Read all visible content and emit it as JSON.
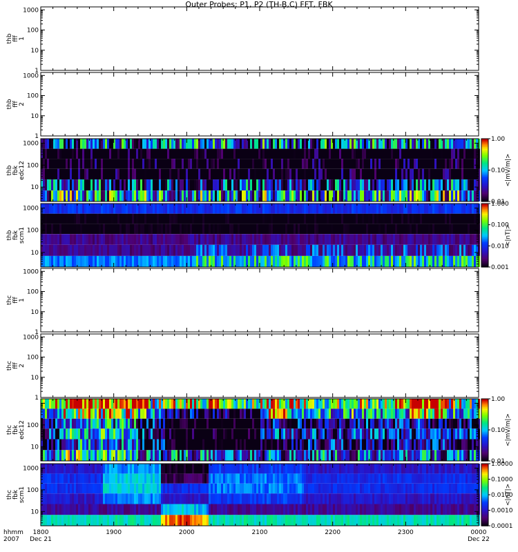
{
  "title": "Outer Probes: P1, P2 (TH-B,C) FFT, FBK",
  "x_axis": {
    "row_label_1": "hhmm",
    "row_label_2": "2007",
    "ticks": [
      {
        "t": "1800",
        "d": "Dec 21"
      },
      {
        "t": "1900",
        "d": ""
      },
      {
        "t": "2000",
        "d": ""
      },
      {
        "t": "2100",
        "d": ""
      },
      {
        "t": "2200",
        "d": ""
      },
      {
        "t": "2300",
        "d": ""
      },
      {
        "t": "0000",
        "d": "Dec 22"
      }
    ]
  },
  "panels": [
    {
      "label": [
        "thb",
        "fff",
        "1"
      ],
      "colorbar": null
    },
    {
      "label": [
        "thb",
        "fff",
        "2"
      ],
      "colorbar": null
    },
    {
      "label": [
        "thb",
        "fbk",
        "edc12"
      ],
      "colorbar": {
        "unit": "<|mV/m|>",
        "ticks": [
          "1.00",
          "0.10",
          "0.01"
        ]
      }
    },
    {
      "label": [
        "thb",
        "fbk",
        "scm1"
      ],
      "colorbar": {
        "unit": "<|nT|>",
        "ticks": [
          "1.000",
          "0.100",
          "0.010",
          "0.001"
        ]
      }
    },
    {
      "label": [
        "thc",
        "fff",
        "1"
      ],
      "colorbar": null
    },
    {
      "label": [
        "thc",
        "fff",
        "2"
      ],
      "colorbar": null
    },
    {
      "label": [
        "thc",
        "fbk",
        "edc12"
      ],
      "colorbar": {
        "unit": "<|mV/m|>",
        "ticks": [
          "1.00",
          "0.10",
          "0.01"
        ]
      }
    },
    {
      "label": [
        "thc",
        "fbk",
        "scm1"
      ],
      "colorbar": {
        "unit": "<|nT|>",
        "ticks": [
          "1.0000",
          "0.1000",
          "0.0100",
          "0.0010",
          "0.0001"
        ]
      }
    }
  ],
  "chart_data": [
    {
      "type": "heatmap",
      "panel": "thb fff 1",
      "y_scale": "log",
      "ylim": [
        1,
        1400
      ],
      "y_ticks": [
        "1000",
        "100",
        "10",
        "1"
      ],
      "values": "no data plotted"
    },
    {
      "type": "heatmap",
      "panel": "thb fff 2",
      "y_scale": "log",
      "ylim": [
        1,
        1400
      ],
      "y_ticks": [
        "1000",
        "100",
        "10",
        "1"
      ],
      "values": "no data plotted"
    },
    {
      "type": "heatmap",
      "panel": "thb fbk edc12",
      "y_scale": "log",
      "y_ticks": [
        "1000",
        "100",
        "10"
      ],
      "z_unit": "<|mV/m|>",
      "z_scale": "log",
      "zlim": [
        0.01,
        1
      ],
      "bands_hz": [
        2600,
        700,
        180,
        45,
        11,
        3
      ],
      "band_levels_approx": [
        0.05,
        0.003,
        0.004,
        0.004,
        0.03,
        0.08
      ],
      "variability": "high, spiky across 1800-0000"
    },
    {
      "type": "heatmap",
      "panel": "thb fbk scm1",
      "y_scale": "log",
      "y_ticks": [
        "1000",
        "100",
        "10"
      ],
      "z_unit": "<|nT|>",
      "z_scale": "log",
      "zlim": [
        0.001,
        1
      ],
      "bands_hz": [
        2600,
        700,
        180,
        45,
        11,
        3
      ],
      "band_levels_approx": [
        0.01,
        0.0008,
        0.0008,
        0.003,
        0.003,
        0.02
      ],
      "variability": "enhancements in 10 Hz band after 2030"
    },
    {
      "type": "heatmap",
      "panel": "thc fff 1",
      "y_scale": "log",
      "ylim": [
        1,
        1400
      ],
      "y_ticks": [
        "1000",
        "100",
        "10",
        "1"
      ],
      "values": "no data plotted"
    },
    {
      "type": "heatmap",
      "panel": "thc fff 2",
      "y_scale": "log",
      "ylim": [
        1,
        1400
      ],
      "y_ticks": [
        "1000",
        "100",
        "10",
        "1"
      ],
      "values": "no data plotted"
    },
    {
      "type": "heatmap",
      "panel": "thc fbk edc12",
      "y_scale": "log",
      "y_ticks": [
        "100",
        "10"
      ],
      "z_unit": "<|mV/m|>",
      "z_scale": "log",
      "zlim": [
        0.01,
        1
      ],
      "bands_hz": [
        2600,
        700,
        180,
        45,
        11,
        3
      ],
      "band_levels_approx": [
        0.3,
        0.1,
        0.02,
        0.03,
        0.02,
        0.05
      ],
      "variability": "broadband enhancement near 1830-1930; quiet 1930-2100"
    },
    {
      "type": "heatmap",
      "panel": "thc fbk scm1",
      "y_scale": "log",
      "y_ticks": [
        "1000",
        "100",
        "10"
      ],
      "z_unit": "<|nT|>",
      "z_scale": "log",
      "zlim": [
        0.0001,
        1
      ],
      "bands_hz": [
        2600,
        700,
        180,
        45,
        11,
        3
      ],
      "band_levels_approx": [
        0.001,
        0.002,
        0.002,
        0.001,
        0.0005,
        0.02
      ],
      "variability": "strong low-frequency enhancement 1955-2040"
    }
  ]
}
